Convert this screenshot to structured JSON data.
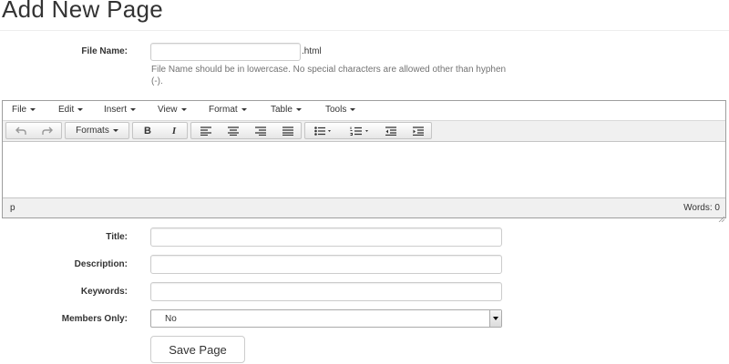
{
  "page": {
    "title": "Add New Page"
  },
  "file_name": {
    "label": "File Name:",
    "value": "",
    "suffix": ".html",
    "help": "File Name should be in lowercase. No special characters are allowed other than hyphen (-)."
  },
  "editor": {
    "menus": [
      "File",
      "Edit",
      "Insert",
      "View",
      "Format",
      "Table",
      "Tools"
    ],
    "formats_label": "Formats",
    "bold_label": "B",
    "italic_label": "I",
    "status_path": "p",
    "word_count": "Words: 0"
  },
  "fields": {
    "title_label": "Title:",
    "title_value": "",
    "description_label": "Description:",
    "description_value": "",
    "keywords_label": "Keywords:",
    "keywords_value": "",
    "members_label": "Members Only:",
    "members_value": "No"
  },
  "actions": {
    "save_label": "Save Page"
  }
}
